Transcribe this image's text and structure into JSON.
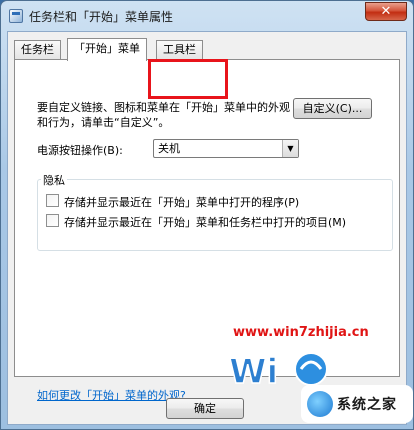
{
  "window": {
    "title": "任务栏和「开始」菜单属性",
    "close_glyph": "✕"
  },
  "tabs": [
    {
      "label": "任务栏"
    },
    {
      "label": "「开始」菜单"
    },
    {
      "label": "工具栏"
    }
  ],
  "active_tab": "「开始」菜单",
  "highlight_color": "#e8141b",
  "panel": {
    "description": "要自定义链接、图标和菜单在「开始」菜单中的外观和行为，请单击“自定义”。",
    "customize_button": "自定义(C)...",
    "power_label": "电源按钮操作(B):",
    "power_value": "关机",
    "privacy_title": "隐私",
    "privacy_options": [
      {
        "label": "存储并显示最近在「开始」菜单中打开的程序(P)",
        "checked": false
      },
      {
        "label": "存储并显示最近在「开始」菜单和任务栏中打开的项目(M)",
        "checked": false
      }
    ],
    "help_link": "如何更改「开始」菜单的外观?"
  },
  "footer": {
    "ok_button": "确定"
  },
  "watermark": {
    "url": "www.win7zhijia.cn",
    "site_name": "系统之家"
  }
}
